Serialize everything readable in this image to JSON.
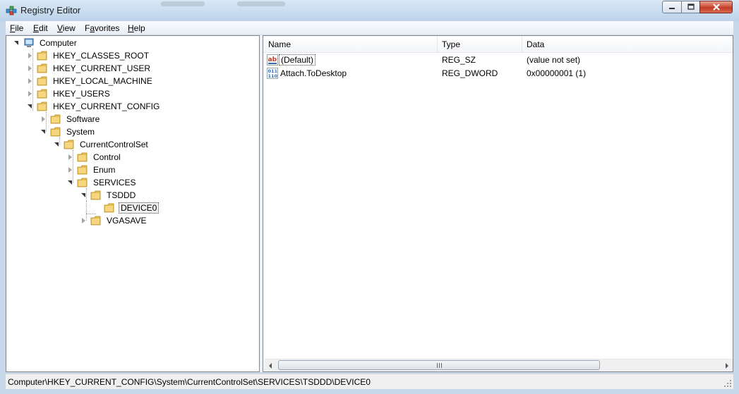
{
  "window": {
    "title": "Registry Editor"
  },
  "menu": [
    {
      "key": "F",
      "rest": "ile"
    },
    {
      "key": "E",
      "rest": "dit"
    },
    {
      "key": "V",
      "rest": "iew"
    },
    {
      "key": "",
      "pre": "F",
      "ul": "a",
      "post": "vorites"
    },
    {
      "key": "H",
      "rest": "elp"
    }
  ],
  "menu_labels": [
    "File",
    "Edit",
    "View",
    "Favorites",
    "Help"
  ],
  "tree": {
    "root": "Computer",
    "nodes": [
      "HKEY_CLASSES_ROOT",
      "HKEY_CURRENT_USER",
      "HKEY_LOCAL_MACHINE",
      "HKEY_USERS",
      "HKEY_CURRENT_CONFIG",
      "Software",
      "System",
      "CurrentControlSet",
      "Control",
      "Enum",
      "SERVICES",
      "TSDDD",
      "DEVICE0",
      "VGASAVE"
    ]
  },
  "list": {
    "columns": [
      "Name",
      "Type",
      "Data"
    ],
    "rows": [
      {
        "name": "(Default)",
        "type": "REG_SZ",
        "data": "(value not set)",
        "icon": "string-value-icon"
      },
      {
        "name": "Attach.ToDesktop",
        "type": "REG_DWORD",
        "data": "0x00000001 (1)",
        "icon": "binary-value-icon"
      }
    ]
  },
  "status": {
    "path": "Computer\\HKEY_CURRENT_CONFIG\\System\\CurrentControlSet\\SERVICES\\TSDDD\\DEVICE0"
  },
  "colors": {
    "folder": "#e8c15a",
    "titlebar": "#c9dcef",
    "close": "#c94a33"
  }
}
